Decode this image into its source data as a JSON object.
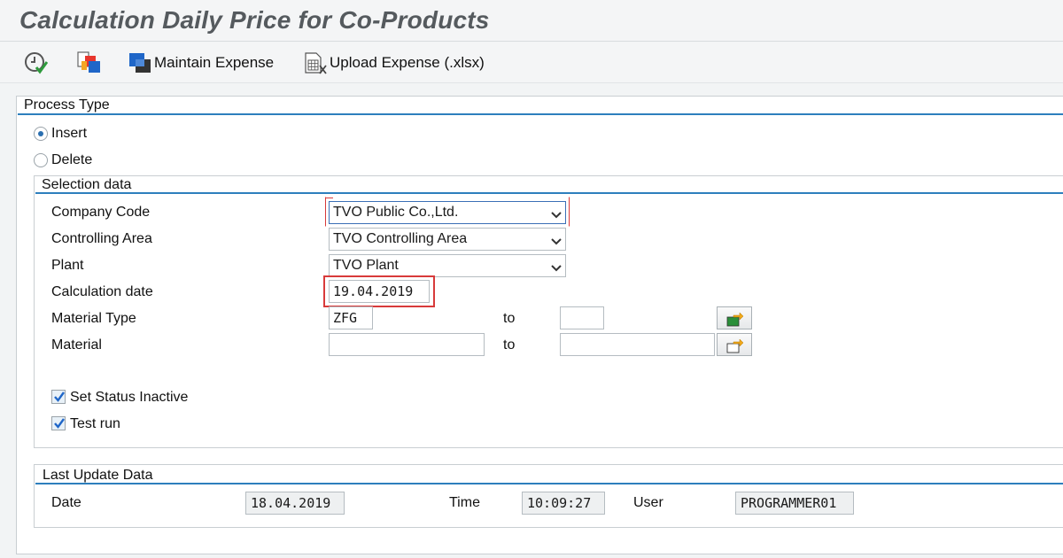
{
  "app": {
    "title": "Calculation Daily Price for Co-Products"
  },
  "toolbar": {
    "execute_icon": "execute-clock-check-icon",
    "variant_icon": "get-variant-icon",
    "maintain_expense_label": "Maintain Expense",
    "upload_expense_label": "Upload Expense (.xlsx)"
  },
  "process_type": {
    "title": "Process Type",
    "options": [
      {
        "label": "Insert",
        "selected": true
      },
      {
        "label": "Delete",
        "selected": false
      }
    ]
  },
  "selection": {
    "title": "Selection data",
    "company_code": {
      "label": "Company Code",
      "value": "TVO Public Co.,Ltd."
    },
    "controlling_area": {
      "label": "Controlling Area",
      "value": "TVO Controlling Area"
    },
    "plant": {
      "label": "Plant",
      "value": "TVO Plant"
    },
    "calculation_date": {
      "label": "Calculation date",
      "value": "19.04.2019"
    },
    "material_type": {
      "label": "Material Type",
      "from": "ZFG",
      "to_label": "to",
      "to": ""
    },
    "material": {
      "label": "Material",
      "from": "",
      "to_label": "to",
      "to": ""
    },
    "set_status_inactive": {
      "label": "Set Status Inactive",
      "checked": true
    },
    "test_run": {
      "label": "Test run",
      "checked": true
    }
  },
  "last_update": {
    "title": "Last Update Data",
    "date_label": "Date",
    "date_value": "18.04.2019",
    "time_label": "Time",
    "time_value": "10:09:27",
    "user_label": "User",
    "user_value": "PROGRAMMER01"
  },
  "colors": {
    "accent_line": "#2d7fbd",
    "highlight": "#d83a3a"
  }
}
